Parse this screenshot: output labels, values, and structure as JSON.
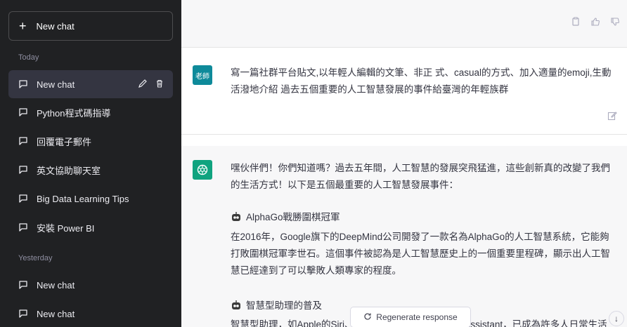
{
  "sidebar": {
    "new_chat_label": "New chat",
    "sections": [
      {
        "label": "Today",
        "items": [
          {
            "label": "New chat",
            "active": true
          },
          {
            "label": "Python程式碼指導"
          },
          {
            "label": "回覆電子郵件"
          },
          {
            "label": "英文協助聊天室"
          },
          {
            "label": "Big Data Learning Tips"
          },
          {
            "label": "安裝 Power BI"
          }
        ]
      },
      {
        "label": "Yesterday",
        "items": [
          {
            "label": "New chat"
          },
          {
            "label": "New chat"
          }
        ]
      }
    ]
  },
  "conversation": {
    "user": {
      "avatar_text": "老師",
      "message": "寫一篇社群平台貼文,以年輕人編輯的文筆、非正 式、casual的方式、加入適量的emoji,生動活潑地介紹 過去五個重要的人工智慧發展的事件給臺灣的年輕族群"
    },
    "assistant": {
      "intro": "嘿伙伴們！你們知道嗎？過去五年間，人工智慧的發展突飛猛進，這些創新真的改變了我們的生活方式！以下是五個最重要的人工智慧發展事件：",
      "heading1": "AlphaGo戰勝圍棋冠軍",
      "para1": "在2016年，Google旗下的DeepMind公司開發了一款名為AlphaGo的人工智慧系統，它能夠打敗圍棋冠軍李世石。這個事件被認為是人工智慧歷史上的一個重要里程碑，顯示出人工智慧已經達到了可以擊敗人類專家的程度。",
      "heading2": "智慧型助理的普及",
      "para2": "智慧型助理，如Apple的Siri、Amazon的Alexa、Google Assistant，已成為許多人日常生活"
    }
  },
  "controls": {
    "regenerate_label": "Regenerate response",
    "scroll_down_glyph": "↓"
  },
  "colors": {
    "sidebar_bg": "#202123",
    "active_item_bg": "#343541",
    "user_avatar_bg": "#0e8a9a",
    "gpt_avatar_bg": "#10a37f",
    "assistant_bg": "#f7f7f8"
  }
}
